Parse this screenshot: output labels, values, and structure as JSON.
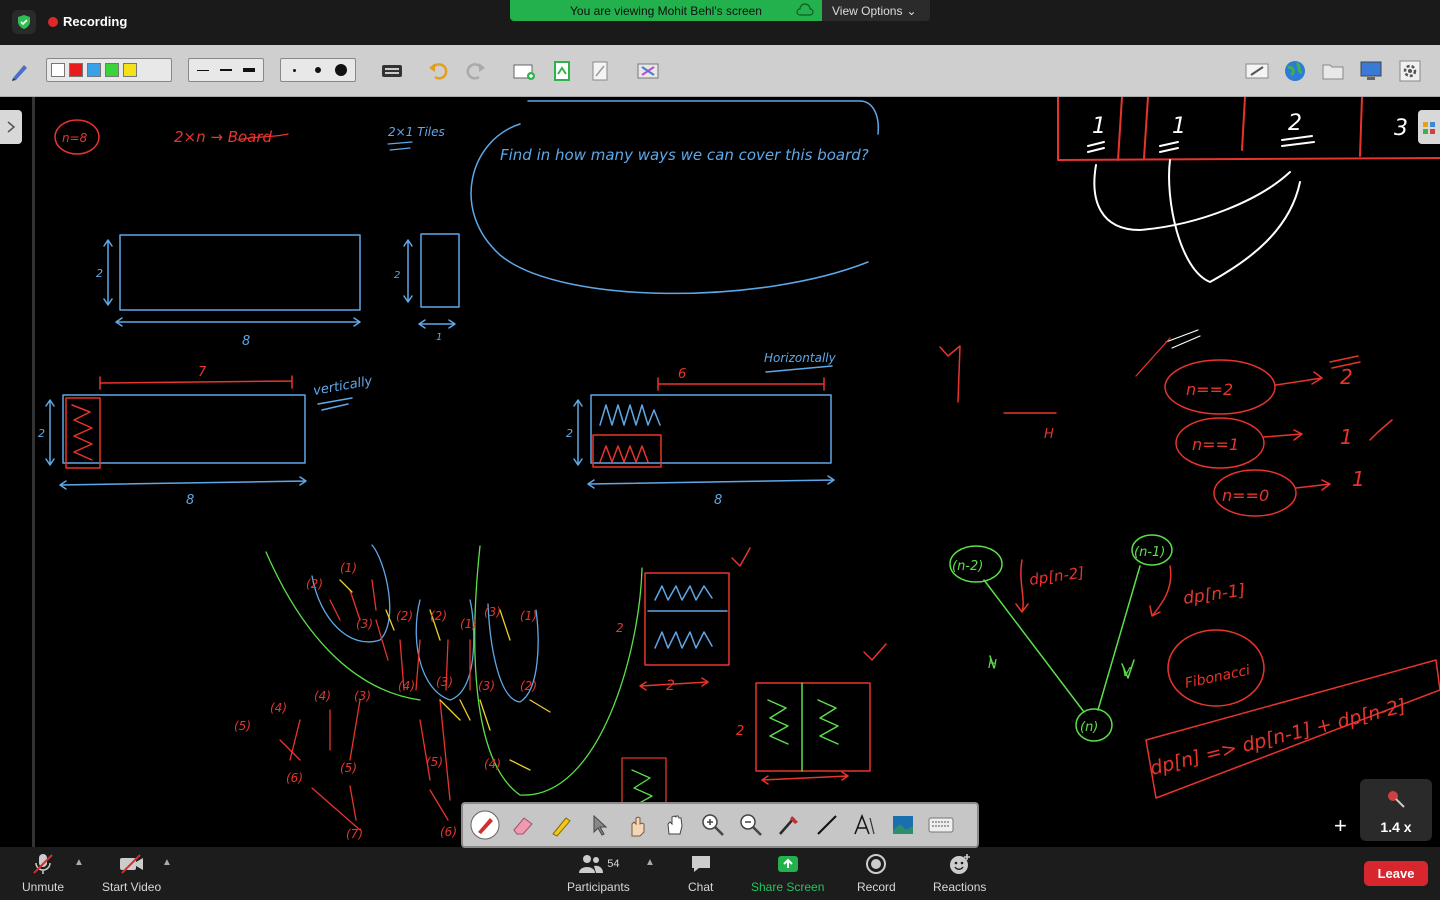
{
  "top": {
    "recording_label": "Recording",
    "viewing_text": "You are viewing Mohit Behl's screen",
    "view_options_label": "View Options"
  },
  "bottom": {
    "unmute_label": "Unmute",
    "start_video_label": "Start Video",
    "participants_label": "Participants",
    "participants_count": "54",
    "chat_label": "Chat",
    "share_screen_label": "Share Screen",
    "record_label": "Record",
    "reactions_label": "Reactions",
    "leave_label": "Leave"
  },
  "zoom": {
    "level": "1.4 x"
  },
  "annotation_colors": [
    "#ffffff",
    "#e81c1c",
    "#3aa0e8",
    "#3ad43a",
    "#f3e21a"
  ],
  "colors": {
    "blue_ink": "#5fa8e8",
    "red_ink": "#e8342c",
    "green_ink": "#5be04a",
    "yellow_ink": "#e8d12a",
    "white_ink": "#ffffff",
    "recording_red": "#e02828",
    "share_green": "#22b14c"
  },
  "whiteboard": {
    "n_eq_8": "n=8",
    "board_label": "2×n → Board",
    "tiles_label": "2×1 Tiles",
    "question": "Find in how many ways we can cover this board?",
    "rect1_height": "2",
    "rect1_width": "8",
    "tile_height": "2",
    "tile_width": "1",
    "vertically": "vertically",
    "vert_top_len": "7",
    "vert_height": "2",
    "vert_width": "8",
    "horizontally": "Horizontally",
    "horiz_top_len": "6",
    "horiz_height": "2",
    "horiz_width": "8",
    "right_col": [
      "1",
      "1",
      "2",
      "3"
    ],
    "base_cases": [
      "n==2",
      "n==1",
      "n==0"
    ],
    "base_values": [
      "2",
      "1",
      "1"
    ],
    "dp_n2": "dp[n-2]",
    "dp_n1": "dp[n-1]",
    "node_n2": "(n-2)",
    "node_n1": "(n-1)",
    "node_n": "(n)",
    "fibonacci": "Fibonacci",
    "recurrence": "dp[n] => dp[n-1] + dp[n-2]",
    "small_box_width": "2",
    "small_box_height": "2",
    "v_label": "V",
    "h_label": "H"
  }
}
